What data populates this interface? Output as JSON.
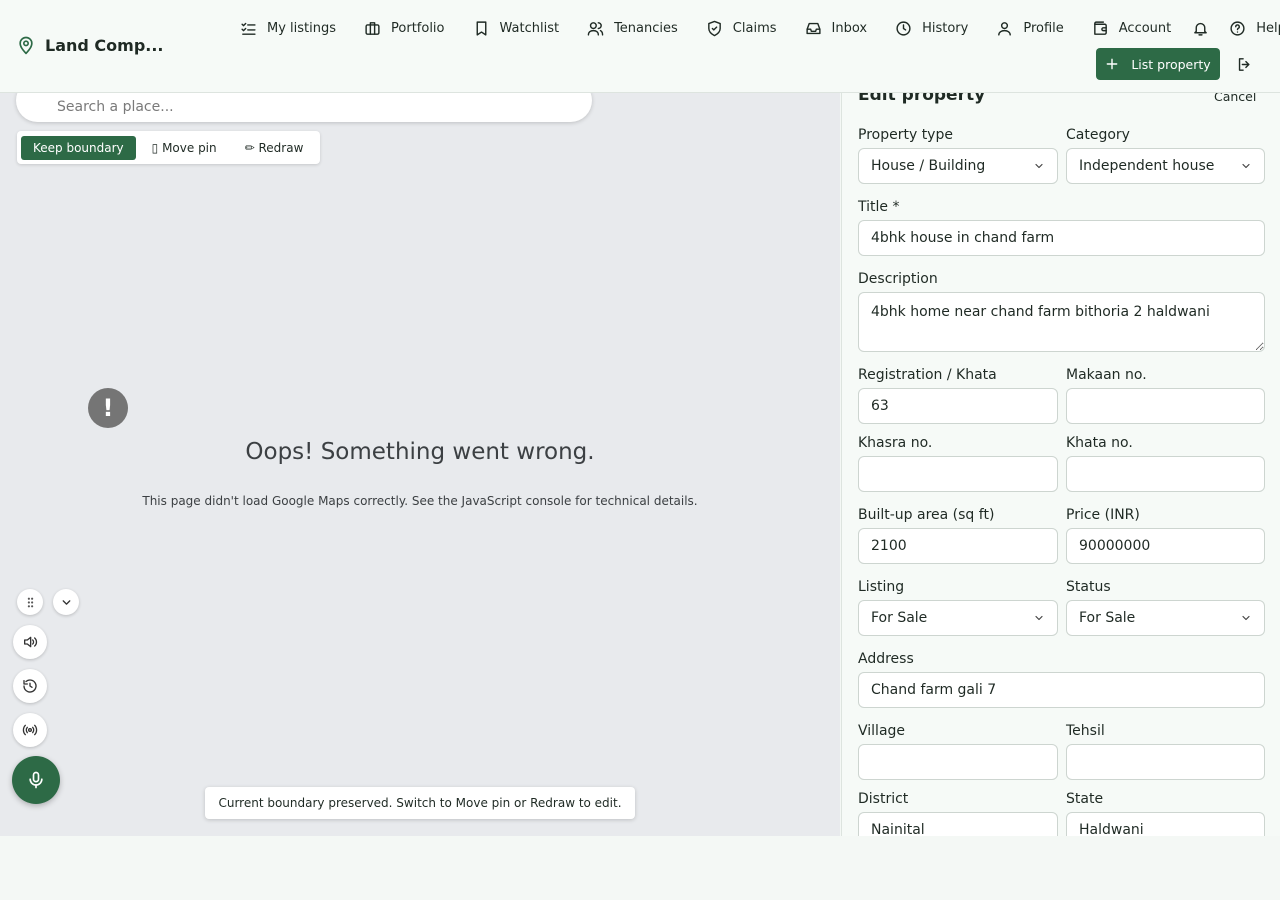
{
  "brand": {
    "name": "Land Comp..."
  },
  "nav": {
    "items": [
      {
        "label": "My listings",
        "icon": "checklist-icon"
      },
      {
        "label": "Portfolio",
        "icon": "briefcase-icon"
      },
      {
        "label": "Watchlist",
        "icon": "bookmark-icon"
      },
      {
        "label": "Tenancies",
        "icon": "users-icon"
      },
      {
        "label": "Claims",
        "icon": "shield-check-icon"
      },
      {
        "label": "Inbox",
        "icon": "inbox-icon"
      },
      {
        "label": "History",
        "icon": "clock-icon"
      },
      {
        "label": "Profile",
        "icon": "user-icon"
      },
      {
        "label": "Account",
        "icon": "wallet-icon"
      },
      {
        "label": "Help",
        "icon": "help-circle-icon"
      }
    ],
    "list_property": "List property"
  },
  "map": {
    "search_placeholder": "Search a place...",
    "modes": {
      "keep": "Keep boundary",
      "move": "▯ Move pin",
      "redraw": "✏ Redraw"
    },
    "error_icon": "!",
    "error_title": "Oops! Something went wrong.",
    "error_text": "This page didn't load Google Maps correctly. See the JavaScript console for technical details.",
    "toast": "Current boundary preserved. Switch to Move pin or Redraw to edit."
  },
  "form": {
    "title": "Edit property",
    "cancel": "Cancel",
    "property_type": {
      "label": "Property type",
      "value": "House / Building"
    },
    "category": {
      "label": "Category",
      "value": "Independent house"
    },
    "title_field": {
      "label": "Title *",
      "value": "4bhk house in chand farm"
    },
    "description": {
      "label": "Description",
      "value": "4bhk home near chand farm bithoria 2 haldwani"
    },
    "registration": {
      "label": "Registration / Khata",
      "value": "63"
    },
    "makaan": {
      "label": "Makaan no.",
      "value": ""
    },
    "khasra": {
      "label": "Khasra no.",
      "value": ""
    },
    "khata": {
      "label": "Khata no.",
      "value": ""
    },
    "built_up": {
      "label": "Built-up area (sq ft)",
      "value": "2100"
    },
    "price": {
      "label": "Price (INR)",
      "value": "90000000"
    },
    "listing": {
      "label": "Listing",
      "value": "For Sale"
    },
    "status": {
      "label": "Status",
      "value": "For Sale"
    },
    "address": {
      "label": "Address",
      "value": "Chand farm gali 7"
    },
    "village": {
      "label": "Village",
      "value": ""
    },
    "tehsil": {
      "label": "Tehsil",
      "value": ""
    },
    "district": {
      "label": "District",
      "value": "Nainital"
    },
    "state": {
      "label": "State",
      "value": "Haldwani"
    }
  },
  "colors": {
    "accent": "#2d6a46",
    "map_bg": "#e8eaed",
    "panel_bg": "#f6faf7"
  }
}
